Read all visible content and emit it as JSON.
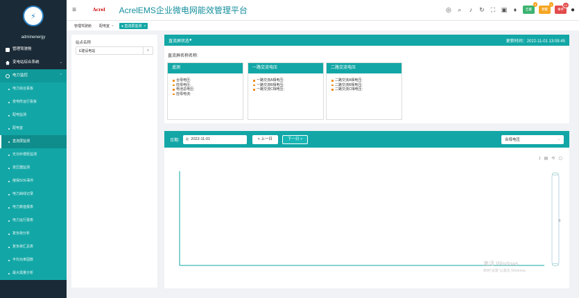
{
  "app": {
    "title": "AcrelEMS企业微电网能效管理平台",
    "brand": "Acrel"
  },
  "sidebar": {
    "user": "adminenergy",
    "items": [
      {
        "label": "管理驾驶舱"
      },
      {
        "label": "变电站综合系统"
      },
      {
        "label": "电力监控"
      }
    ],
    "subitems": [
      {
        "label": "电力综合看板"
      },
      {
        "label": "变电所运行看板"
      },
      {
        "label": "配电监测"
      },
      {
        "label": "配电室"
      },
      {
        "label": "直流屏监测"
      },
      {
        "label": "无功补偿柜监测"
      },
      {
        "label": "变压器监测"
      },
      {
        "label": "继保SOE事件"
      },
      {
        "label": "电力曲线记录"
      },
      {
        "label": "电力数值报表"
      },
      {
        "label": "电力运行报表"
      },
      {
        "label": "复负荷分析"
      },
      {
        "label": "复负荷汇总表"
      },
      {
        "label": "平均功率因数"
      },
      {
        "label": "最大需量分析"
      }
    ]
  },
  "topbar": {
    "badges": [
      {
        "label": "告警",
        "count": "0"
      },
      {
        "label": "预警",
        "count": "1"
      },
      {
        "label": "事件",
        "count": "10"
      }
    ]
  },
  "tabs": [
    {
      "label": "管理驾驶舱"
    },
    {
      "label": "配电室"
    },
    {
      "label": "直流屏监测"
    }
  ],
  "station": {
    "label": "站点名称",
    "value": "E建设电站"
  },
  "dc_status": {
    "title": "直流屏状态",
    "updated": "更新时间：2022-11-01 13:09:45",
    "subtitle": "直流屏名称名称:",
    "cards": [
      {
        "title": "遥测",
        "rows": [
          "合母电压:",
          "控母电压:",
          "电池总电压:",
          "控母电流:"
        ]
      },
      {
        "title": "一路交流电压",
        "rows": [
          "一路交流A相电压:",
          "一路交流B相电压:",
          "一路交流C相电压:"
        ]
      },
      {
        "title": "二路交流电压",
        "rows": [
          "二路交流A相电压:",
          "二路交流B相电压:",
          "二路交流C相电压:"
        ]
      }
    ]
  },
  "chart_panel": {
    "date_label": "日期:",
    "date_value": "2022-11-01",
    "prev_label": "< 上一日",
    "next_label": "下一日 >",
    "type_value": "合母电压"
  },
  "watermark": {
    "line1": "激活 Windows",
    "line2": "转到\"设置\"以激活 Windows。"
  }
}
